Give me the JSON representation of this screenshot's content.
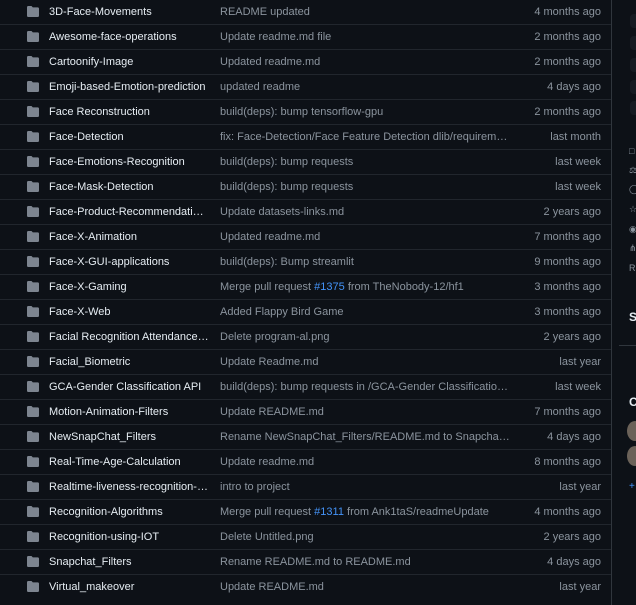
{
  "files": [
    {
      "name": "3D-Face-Movements",
      "message": "README updated",
      "date": "4 months ago"
    },
    {
      "name": "Awesome-face-operations",
      "message": "Update readme.md file",
      "date": "2 months ago"
    },
    {
      "name": "Cartoonify-Image",
      "message": "Updated readme.md",
      "date": "2 months ago"
    },
    {
      "name": "Emoji-based-Emotion-prediction",
      "message": "updated readme",
      "date": "4 days ago"
    },
    {
      "name": "Face Reconstruction",
      "message": "build(deps): bump tensorflow-gpu",
      "date": "2 months ago"
    },
    {
      "name": "Face-Detection",
      "message": "fix: Face-Detection/Face Feature Detection dlib/requirements.txt to r...",
      "date": "last month"
    },
    {
      "name": "Face-Emotions-Recognition",
      "message": "build(deps): bump requests",
      "date": "last week"
    },
    {
      "name": "Face-Mask-Detection",
      "message": "build(deps): bump requests",
      "date": "last week"
    },
    {
      "name": "Face-Product-Recommendation-Syst...",
      "message": "Update datasets-links.md",
      "date": "2 years ago"
    },
    {
      "name": "Face-X-Animation",
      "message": "Updated readme.md",
      "date": "7 months ago"
    },
    {
      "name": "Face-X-GUI-applications",
      "message": "build(deps): Bump streamlit",
      "date": "9 months ago"
    },
    {
      "name": "Face-X-Gaming",
      "message_before": "Merge pull request ",
      "message_link": "#1375",
      "message_after": " from TheNobody-12/hf1",
      "date": "3 months ago"
    },
    {
      "name": "Face-X-Web",
      "message": "Added Flappy Bird Game",
      "date": "3 months ago"
    },
    {
      "name": "Facial Recognition Attendance Mana...",
      "message": "Delete program-al.png",
      "date": "2 years ago"
    },
    {
      "name": "Facial_Biometric",
      "message": "Update Readme.md",
      "date": "last year"
    },
    {
      "name": "GCA-Gender Classification API",
      "message": "build(deps): bump requests in /GCA-Gender Classification API",
      "date": "last week"
    },
    {
      "name": "Motion-Animation-Filters",
      "message": "Update README.md",
      "date": "7 months ago"
    },
    {
      "name": "NewSnapChat_Filters",
      "message": "Rename NewSnapChat_Filters/README.md to Snapchat_filters/swirly_filt...",
      "date": "4 days ago"
    },
    {
      "name": "Real-Time-Age-Calculation",
      "message": "Update readme.md",
      "date": "8 months ago"
    },
    {
      "name": "Realtime-liveness-recognition-system",
      "message": "intro to project",
      "date": "last year"
    },
    {
      "name": "Recognition-Algorithms",
      "message_before": "Merge pull request ",
      "message_link": "#1311",
      "message_after": " from Ank1taS/readmeUpdate",
      "date": "4 months ago"
    },
    {
      "name": "Recognition-using-IOT",
      "message": "Delete Untitled.png",
      "date": "2 years ago"
    },
    {
      "name": "Snapchat_Filters",
      "message": "Rename README.md to README.md",
      "date": "4 days ago"
    },
    {
      "name": "Virtual_makeover",
      "message": "Update README.md",
      "date": "last year"
    }
  ],
  "sidebar": {
    "heading_s": "S",
    "heading_c": "C",
    "plus": "+",
    "letter_r": "R"
  },
  "icons": {
    "folder": "folder-icon",
    "folder_color": "#7d8590"
  },
  "colors": {
    "background": "#0d1117",
    "border": "#21262d",
    "text": "#e6edf3",
    "muted": "#8b949e",
    "link": "#4493f8"
  }
}
